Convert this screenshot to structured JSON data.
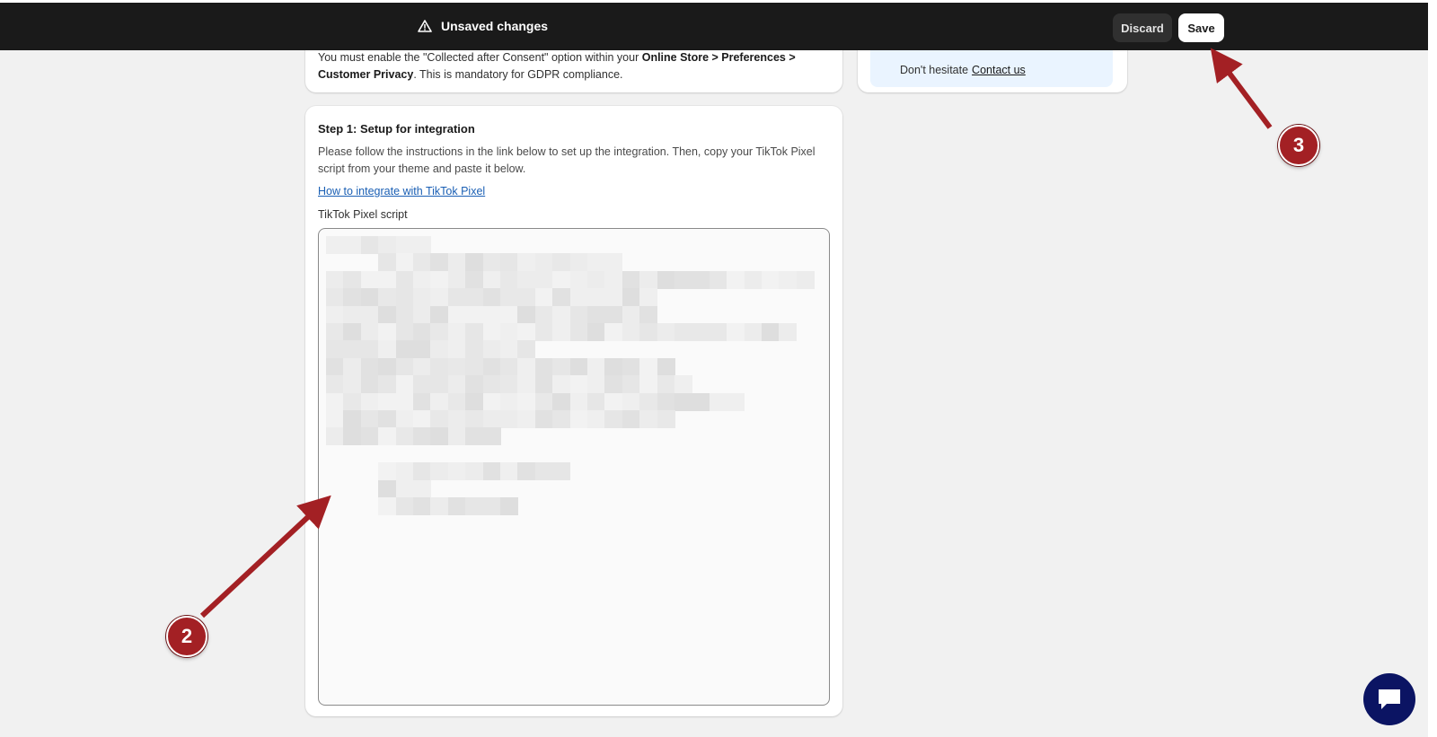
{
  "topbar": {
    "status": "Unsaved changes",
    "discard_label": "Discard",
    "save_label": "Save"
  },
  "consent_card": {
    "line1_pre": "You must enable the \"Collected after Consent\" option within your ",
    "line1_bold": "Online Store > Preferences >",
    "line2_bold": "Customer Privacy",
    "line2_post": ". This is mandatory for GDPR compliance."
  },
  "side_card": {
    "text": "Don't hesitate",
    "link": "Contact us"
  },
  "step_card": {
    "title": "Step 1: Setup for integration",
    "description": "Please follow the instructions in the link below to set up the integration. Then, copy your TikTok Pixel script from your theme and paste it below.",
    "link": "How to integrate with TikTok Pixel",
    "field_label": "TikTok Pixel script"
  },
  "annotations": {
    "step2": "2",
    "step3": "3"
  },
  "colors": {
    "topbar": "#1a1a1a",
    "annotation": "#a32024",
    "chat": "#0b1463"
  }
}
